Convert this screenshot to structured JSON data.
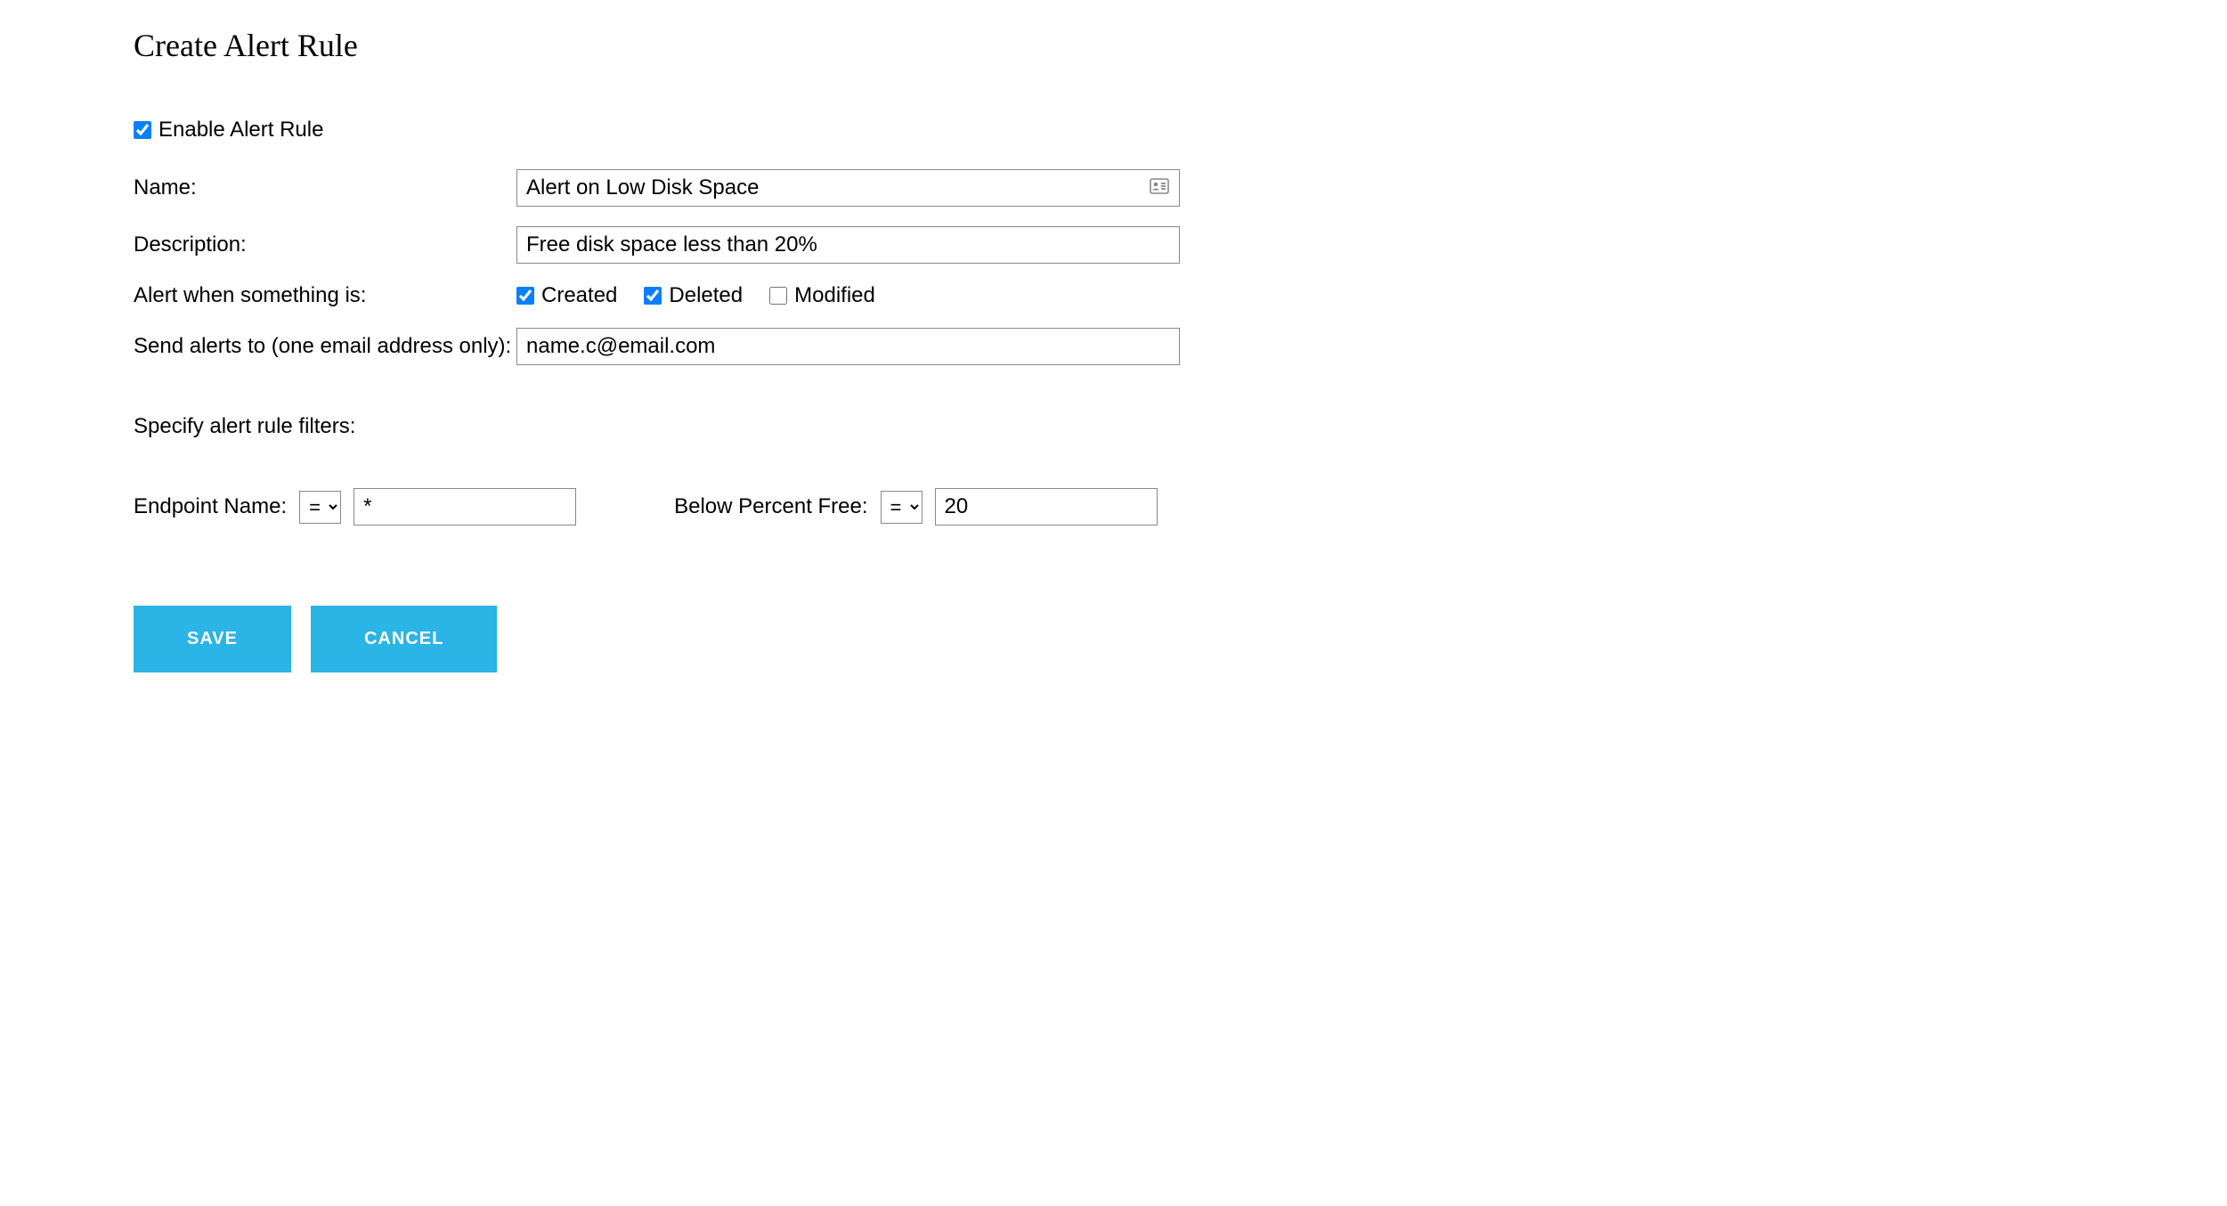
{
  "title": "Create Alert Rule",
  "enable": {
    "label": "Enable Alert Rule",
    "checked": true
  },
  "fields": {
    "name": {
      "label": "Name:",
      "value": "Alert on Low Disk Space"
    },
    "description": {
      "label": "Description:",
      "value": "Free disk space less than 20%"
    },
    "alert_when": {
      "label": "Alert when something is:",
      "options": {
        "created": {
          "label": "Created",
          "checked": true
        },
        "deleted": {
          "label": "Deleted",
          "checked": true
        },
        "modified": {
          "label": "Modified",
          "checked": false
        }
      }
    },
    "send_to": {
      "label": "Send alerts to (one email address only):",
      "value": "name.c@email.com"
    }
  },
  "filters": {
    "label": "Specify alert rule filters:",
    "endpoint": {
      "label": "Endpoint Name:",
      "operator": "=",
      "value": "*"
    },
    "percent_free": {
      "label": "Below Percent Free:",
      "operator": "=",
      "value": "20"
    }
  },
  "buttons": {
    "save": "SAVE",
    "cancel": "CANCEL"
  }
}
